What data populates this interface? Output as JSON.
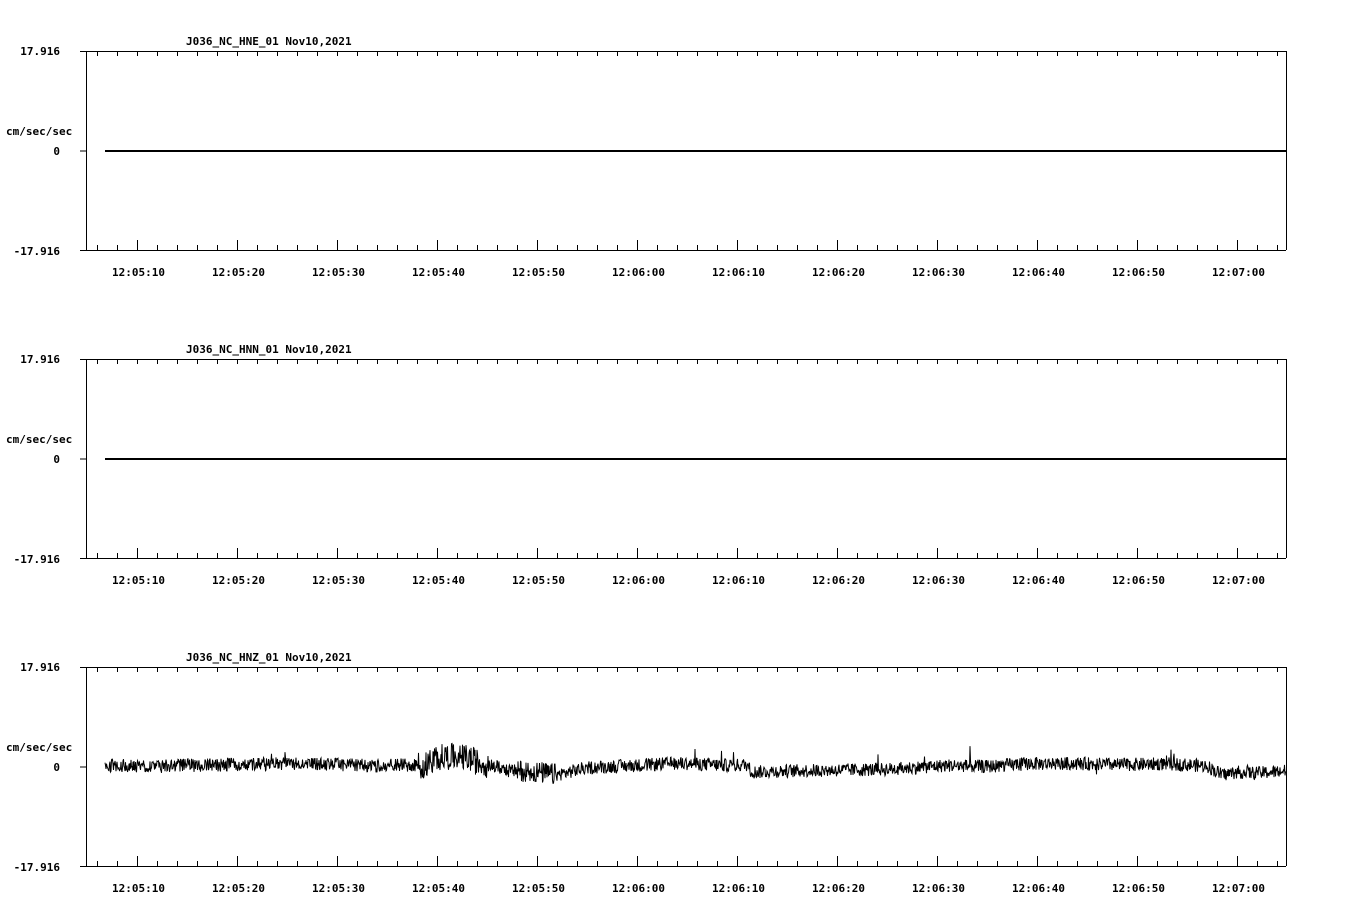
{
  "chart_data": [
    {
      "type": "line",
      "title": "J036_NC_HNE_01   Nov10,2021",
      "ylabel": "cm/sec/sec",
      "ylim": [
        -17.916,
        17.916
      ],
      "y_ticks": [
        "17.916",
        "0",
        "-17.916"
      ],
      "x_ticks": [
        "12:05:10",
        "12:05:20",
        "12:05:30",
        "12:05:40",
        "12:05:50",
        "12:06:00",
        "12:06:10",
        "12:06:20",
        "12:06:30",
        "12:06:40",
        "12:06:50",
        "12:07:00"
      ],
      "x_range_seconds": [
        0,
        120
      ],
      "series": [
        {
          "style": "flat",
          "start_s": 1.8,
          "end_s": 120,
          "values": [
            0,
            0
          ],
          "noise": 0.05,
          "color": "#000000"
        }
      ]
    },
    {
      "type": "line",
      "title": "J036_NC_HNN_01   Nov10,2021",
      "ylabel": "cm/sec/sec",
      "ylim": [
        -17.916,
        17.916
      ],
      "y_ticks": [
        "17.916",
        "0",
        "-17.916"
      ],
      "x_ticks": [
        "12:05:10",
        "12:05:20",
        "12:05:30",
        "12:05:40",
        "12:05:50",
        "12:06:00",
        "12:06:10",
        "12:06:20",
        "12:06:30",
        "12:06:40",
        "12:06:50",
        "12:07:00"
      ],
      "x_range_seconds": [
        0,
        120
      ],
      "series": [
        {
          "style": "flat",
          "start_s": 1.8,
          "end_s": 120,
          "values": [
            0,
            0
          ],
          "noise": 0.05,
          "color": "#000000"
        }
      ]
    },
    {
      "type": "line",
      "title": "J036_NC_HNZ_01   Nov10,2021",
      "ylabel": "cm/sec/sec",
      "ylim": [
        -17.916,
        17.916
      ],
      "y_ticks": [
        "17.916",
        "0",
        "-17.916"
      ],
      "x_ticks": [
        "12:05:10",
        "12:05:20",
        "12:05:30",
        "12:05:40",
        "12:05:50",
        "12:06:00",
        "12:06:10",
        "12:06:20",
        "12:06:30",
        "12:06:40",
        "12:06:50",
        "12:07:00"
      ],
      "x_range_seconds": [
        0,
        120
      ],
      "series": [
        {
          "style": "noisy",
          "start_s": 1.8,
          "end_s": 120,
          "noise": 1.2,
          "color": "#000000",
          "envelope_t": [
            1.8,
            10,
            20,
            25,
            29,
            29.2,
            33,
            34,
            35,
            36,
            38,
            39,
            40,
            42,
            40.5,
            44,
            47,
            50,
            55,
            59,
            64,
            66,
            66.5,
            70,
            80,
            86,
            90,
            94,
            100,
            103,
            108,
            112,
            113.5,
            115,
            117,
            120
          ],
          "envelope_v": [
            0.1,
            0.2,
            0.5,
            0.4,
            0.1,
            0.3,
            0.2,
            0.3,
            1.6,
            1.8,
            1.6,
            0.8,
            0.3,
            -0.5,
            -0.8,
            -0.8,
            -1.5,
            -0.2,
            0.2,
            0.6,
            0.2,
            0.3,
            -1.0,
            -0.8,
            -0.5,
            0.2,
            0.0,
            0.5,
            0.5,
            0.3,
            0.5,
            0.1,
            -1.5,
            -1.0,
            -1.2,
            -0.8
          ]
        }
      ]
    }
  ]
}
